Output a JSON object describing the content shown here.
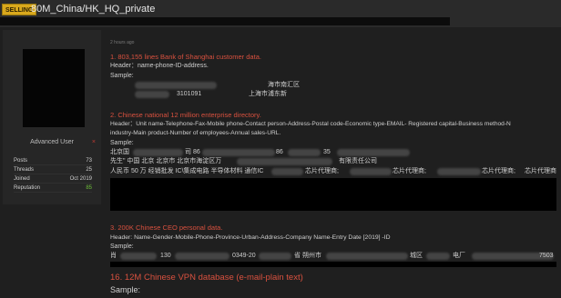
{
  "thread": {
    "badge": "SELLING",
    "title": "80M_China/HK_HQ_private"
  },
  "user": {
    "rank": "Advanced User",
    "rank_mark": "×",
    "stats": [
      {
        "label": "Posts",
        "value": "73"
      },
      {
        "label": "Threads",
        "value": "25"
      },
      {
        "label": "Joined",
        "value": "Oct 2019"
      },
      {
        "label": "Reputation",
        "value": "85"
      }
    ]
  },
  "post": {
    "date": "2 hours ago",
    "sections": [
      {
        "heading": "1. 803,155 lines Bank of Shanghai customer data.",
        "header": "Header：name-phone-ID-address.",
        "sample_label": "Sample:",
        "sample_lines": [
          "海市南汇区",
          "3101091",
          "上海市浦东新"
        ]
      },
      {
        "heading": "2. Chinese national 12 million enterprise directory.",
        "header_1": "Header：Unit name-Telephone-Fax-Mobile phone-Contact person-Address-Postal code-Economic type-EMAIL- Registered capital-Business method-N",
        "header_2": "industry-Main product-Number of employees-Annual sales-URL.",
        "sample_label": "Sample:",
        "sample_lines": [
          "北京国",
          "司 86",
          "86",
          "35",
          "先生\" 中国 北京 北京市 北京市海淀区万",
          "有限责任公司",
          "人民币 50 万 经销批发 IC\\集成电路 半导体材料 通信IC",
          "芯片代理商;",
          "芯片代理商;",
          "芯片代理商;",
          "芯片代理商"
        ]
      },
      {
        "heading": "3. 200K Chinese CEO personal data.",
        "header": "Header: Name-Gender-Mobile-Phone-Province-Urban-Address-Company Name-Entry Date [2019] -ID",
        "sample_label": "Sample:",
        "sample_lines": [
          "肖",
          "130",
          "0349-20",
          "省 朔州市",
          "城区",
          "电厂",
          "7503"
        ]
      },
      {
        "heading": "16. 12M Chinese VPN database (e-mail-plain text)",
        "sample_label": "Sample:"
      }
    ]
  },
  "colors": {
    "heading": "#d9513f",
    "badge": "#d9a81c",
    "reputation": "#6fbf3a"
  }
}
